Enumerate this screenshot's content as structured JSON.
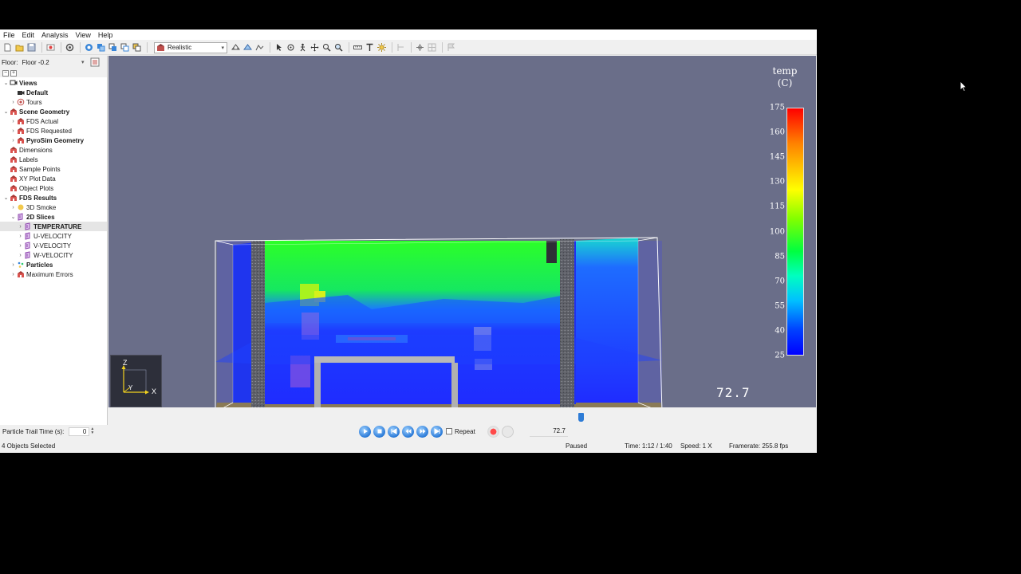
{
  "menu": [
    "File",
    "Edit",
    "Analysis",
    "View",
    "Help"
  ],
  "toolbar": {
    "render_mode": "Realistic",
    "icons": [
      "new-icon",
      "open-icon",
      "save-icon",
      "export-icon",
      "settings-icon",
      "view-fit-icon",
      "view-top-icon",
      "view-front-icon",
      "view-side-icon",
      "view-iso-icon",
      "render-icon",
      "select-icon",
      "orbit-icon",
      "roam-icon",
      "pan-icon",
      "zoom-icon",
      "zoom-box-icon",
      "measure-icon",
      "text-icon",
      "light-icon",
      "clip-icon",
      "align-icon",
      "snap-icon",
      "flag-icon"
    ]
  },
  "left_panel": {
    "floor_label": "Floor:",
    "floor_value": "Floor -0.2",
    "tree": [
      {
        "label": "Views",
        "level": 0,
        "expanded": true,
        "bold": true,
        "icon": "views-icon"
      },
      {
        "label": "Default",
        "level": 1,
        "bold": true,
        "icon": "camera-icon"
      },
      {
        "label": "Tours",
        "level": 1,
        "arrow": true,
        "icon": "tour-icon"
      },
      {
        "label": "Scene Geometry",
        "level": 0,
        "expanded": true,
        "bold": true,
        "icon": "geometry-icon"
      },
      {
        "label": "FDS Actual",
        "level": 1,
        "arrow": true,
        "icon": "geometry-icon"
      },
      {
        "label": "FDS Requested",
        "level": 1,
        "arrow": true,
        "icon": "geometry-icon"
      },
      {
        "label": "PyroSim Geometry",
        "level": 1,
        "arrow": true,
        "bold": true,
        "icon": "geometry-icon"
      },
      {
        "label": "Dimensions",
        "level": 0,
        "icon": "geometry-icon"
      },
      {
        "label": "Labels",
        "level": 0,
        "icon": "geometry-icon"
      },
      {
        "label": "Sample Points",
        "level": 0,
        "icon": "geometry-icon"
      },
      {
        "label": "XY Plot Data",
        "level": 0,
        "icon": "geometry-icon"
      },
      {
        "label": "Object Plots",
        "level": 0,
        "icon": "geometry-icon"
      },
      {
        "label": "FDS Results",
        "level": 0,
        "expanded": true,
        "bold": true,
        "icon": "geometry-icon"
      },
      {
        "label": "3D Smoke",
        "level": 1,
        "arrow": true,
        "icon": "smoke-icon"
      },
      {
        "label": "2D Slices",
        "level": 1,
        "expanded": true,
        "bold": true,
        "icon": "slice-icon"
      },
      {
        "label": "TEMPERATURE",
        "level": 2,
        "arrow": true,
        "bold": true,
        "selected": true,
        "icon": "slice-icon"
      },
      {
        "label": "U-VELOCITY",
        "level": 2,
        "arrow": true,
        "icon": "slice-icon"
      },
      {
        "label": "V-VELOCITY",
        "level": 2,
        "arrow": true,
        "icon": "slice-icon"
      },
      {
        "label": "W-VELOCITY",
        "level": 2,
        "arrow": true,
        "icon": "slice-icon"
      },
      {
        "label": "Particles",
        "level": 1,
        "arrow": true,
        "bold": true,
        "icon": "particles-icon"
      },
      {
        "label": "Maximum Errors",
        "level": 1,
        "arrow": true,
        "icon": "geometry-icon"
      }
    ],
    "particle_trail_label": "Particle Trail Time (s):",
    "particle_trail_value": "0"
  },
  "viewport": {
    "legend_title_1": "temp",
    "legend_title_2": "(C)",
    "legend_ticks": [
      "175",
      "160",
      "145",
      "130",
      "115",
      "100",
      "85",
      "70",
      "55",
      "40",
      "25"
    ],
    "time_readout": "72.7",
    "axis_labels": {
      "z": "Z",
      "y": "Y",
      "x": "X"
    },
    "colors": {
      "background": "#6a6e89",
      "hot": "#ff0000",
      "cold": "#0000ff"
    }
  },
  "playback": {
    "repeat_label": "Repeat",
    "time_value": "72.7",
    "progress": 0.727
  },
  "status": {
    "selection": "4 Objects Selected",
    "state": "Paused",
    "time": "Time: 1:12 / 1:40",
    "speed": "Speed: 1 X",
    "framerate": "Framerate: 255.8 fps"
  }
}
